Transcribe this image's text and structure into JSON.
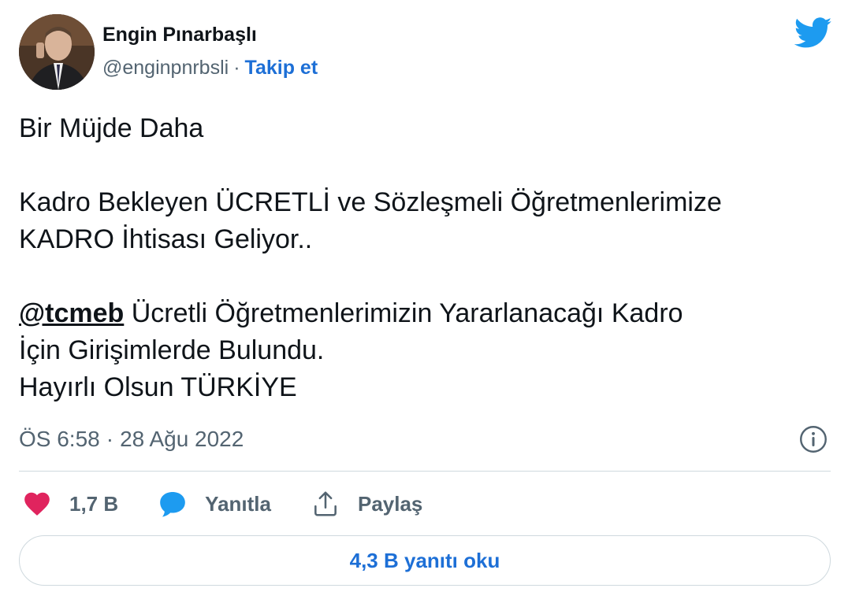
{
  "author": {
    "name": "Engin Pınarbaşlı",
    "handle": "@enginpnrbsli",
    "separator": "·",
    "follow_label": "Takip et"
  },
  "brand": {
    "icon": "twitter-bird-icon",
    "color": "#1d9bf0"
  },
  "tweet": {
    "lines": [
      "Bir Müjde Daha",
      "Kadro Bekleyen ÜCRETLİ ve Sözleşmeli Öğretmenlerimize",
      "KADRO İhtisası Geliyor..",
      "@tcmeb",
      " Ücretli Öğretmenlerimizin Yararlanacağı Kadro",
      "İçin Girişimlerde Bulundu.",
      "Hayırlı Olsun TÜRKİYE"
    ]
  },
  "meta": {
    "time": "ÖS 6:58",
    "separator": "·",
    "date": "28 Ağu 2022",
    "info_icon": "info-icon"
  },
  "actions": {
    "like": {
      "icon": "heart-icon",
      "label": "1,7 B",
      "color": "#e0245e"
    },
    "reply": {
      "icon": "speech-bubble-icon",
      "label": "Yanıtla",
      "color": "#1d9bf0"
    },
    "share": {
      "icon": "share-upload-icon",
      "label": "Paylaş"
    }
  },
  "read_replies_label": "4,3 B yanıtı oku",
  "colors": {
    "link": "#1d6fd6",
    "muted": "#536471",
    "border": "#cfd9de"
  }
}
